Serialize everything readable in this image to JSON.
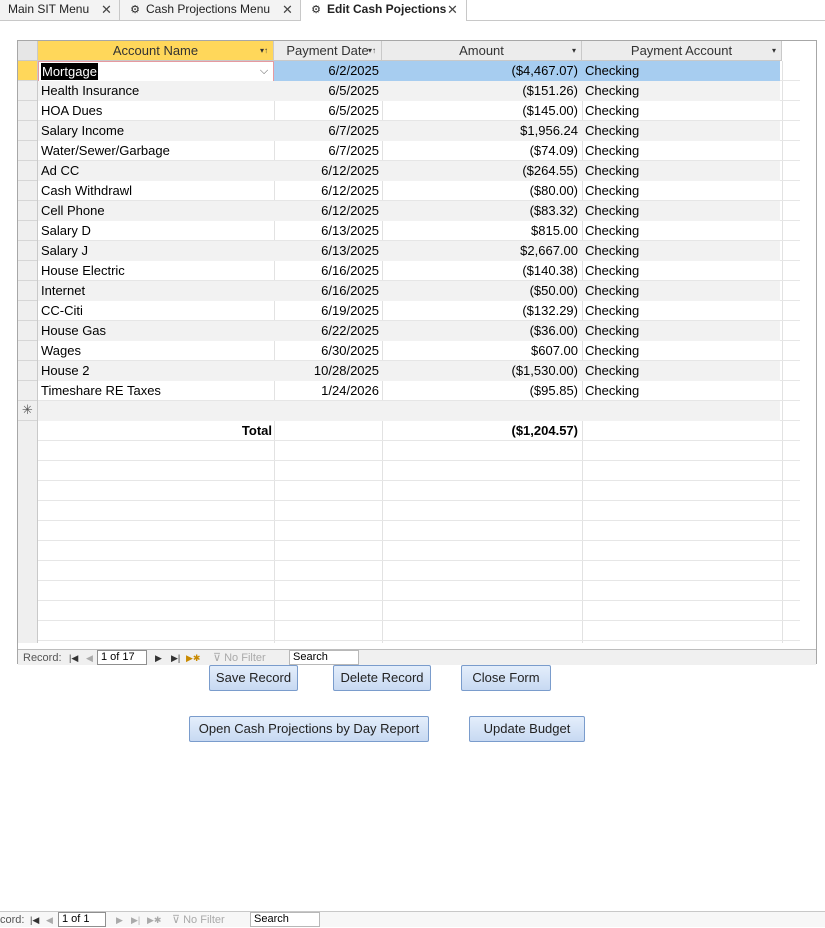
{
  "tabs": [
    {
      "label": "Main SIT Menu",
      "icon": "form-icon"
    },
    {
      "label": "Cash Projections Menu",
      "icon": "macro-gear-icon"
    },
    {
      "label": "Edit Cash Pojections",
      "icon": "macro-gear-icon"
    }
  ],
  "columns": {
    "name": "Account Name",
    "date": "Payment Date",
    "amount": "Amount",
    "account": "Payment Account"
  },
  "rows": [
    {
      "name": "Mortgage",
      "date": "6/2/2025",
      "amount": "($4,467.07)",
      "account": "Checking"
    },
    {
      "name": "Health Insurance",
      "date": "6/5/2025",
      "amount": "($151.26)",
      "account": "Checking"
    },
    {
      "name": "HOA Dues",
      "date": "6/5/2025",
      "amount": "($145.00)",
      "account": "Checking"
    },
    {
      "name": "Salary Income",
      "date": "6/7/2025",
      "amount": "$1,956.24",
      "account": "Checking"
    },
    {
      "name": "Water/Sewer/Garbage",
      "date": "6/7/2025",
      "amount": "($74.09)",
      "account": "Checking"
    },
    {
      "name": "Ad CC",
      "date": "6/12/2025",
      "amount": "($264.55)",
      "account": "Checking"
    },
    {
      "name": "Cash Withdrawl",
      "date": "6/12/2025",
      "amount": "($80.00)",
      "account": "Checking"
    },
    {
      "name": "Cell Phone",
      "date": "6/12/2025",
      "amount": "($83.32)",
      "account": "Checking"
    },
    {
      "name": "Salary D",
      "date": "6/13/2025",
      "amount": "$815.00",
      "account": "Checking"
    },
    {
      "name": "Salary J",
      "date": "6/13/2025",
      "amount": "$2,667.00",
      "account": "Checking"
    },
    {
      "name": "House Electric",
      "date": "6/16/2025",
      "amount": "($140.38)",
      "account": "Checking"
    },
    {
      "name": "Internet",
      "date": "6/16/2025",
      "amount": "($50.00)",
      "account": "Checking"
    },
    {
      "name": "CC-Citi",
      "date": "6/19/2025",
      "amount": "($132.29)",
      "account": "Checking"
    },
    {
      "name": "House Gas",
      "date": "6/22/2025",
      "amount": "($36.00)",
      "account": "Checking"
    },
    {
      "name": "Wages",
      "date": "6/30/2025",
      "amount": "$607.00",
      "account": "Checking"
    },
    {
      "name": "House 2",
      "date": "10/28/2025",
      "amount": "($1,530.00)",
      "account": "Checking"
    },
    {
      "name": "Timeshare RE Taxes",
      "date": "1/24/2026",
      "amount": "($95.85)",
      "account": "Checking"
    }
  ],
  "total": {
    "label": "Total",
    "amount": "($1,204.57)"
  },
  "nav_main": {
    "label": "Record:",
    "position": "1 of 17",
    "filter": "No Filter",
    "search": "Search"
  },
  "nav_outer": {
    "label": "cord:",
    "position": "1 of 1",
    "filter": "No Filter",
    "search": "Search"
  },
  "buttons": {
    "save": "Save Record",
    "delete": "Delete Record",
    "close": "Close Form",
    "report": "Open Cash Projections by Day Report",
    "budget": "Update Budget"
  },
  "colors": {
    "sorted_header": "#ffd75a",
    "selected_row": "#a7cdf0",
    "button_border": "#7a9ccc"
  }
}
